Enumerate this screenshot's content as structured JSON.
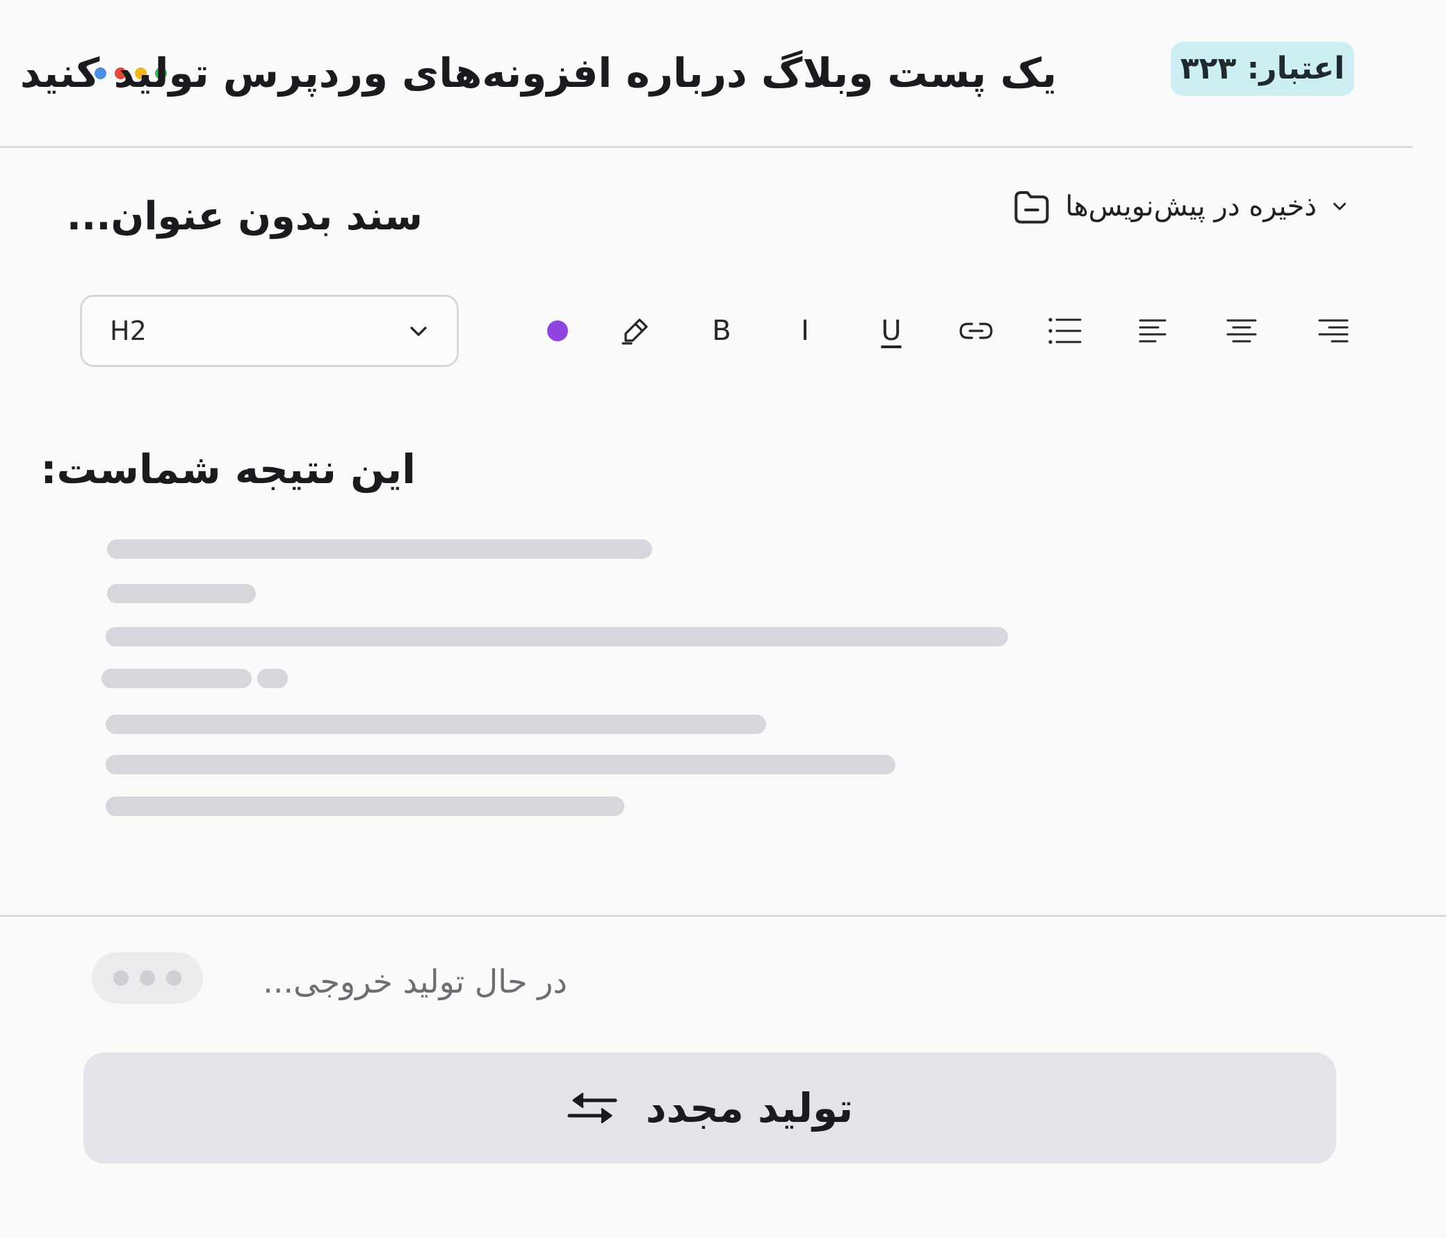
{
  "header": {
    "window_dots": [
      "#4a8fe0",
      "#e1483c",
      "#f2b520",
      "#41b35a"
    ],
    "prompt_title": "یک پست وبلاگ درباره افزونه‌های وردپرس تولید کنید",
    "credit_badge": "اعتبار: ۳۲۳"
  },
  "document": {
    "title": "سند بدون عنوان...",
    "save_dropdown_label": "ذخیره در پیش‌نویس‌ها"
  },
  "toolbar": {
    "heading_select_value": "H2",
    "text_color": "#8f44e0",
    "bold_label": "B",
    "italic_label": "I",
    "underline_label": "U",
    "icons": [
      "text-color-icon",
      "highlighter-icon",
      "bold-icon",
      "italic-icon",
      "underline-icon",
      "link-icon",
      "bullet-list-icon",
      "align-left-icon",
      "align-center-icon",
      "align-right-icon"
    ]
  },
  "content": {
    "result_heading": "این نتیجه شماست:"
  },
  "footer": {
    "status_text": "در حال تولید خروجی...",
    "regenerate_label": "تولید مجدد"
  },
  "colors": {
    "credit_badge_bg": "#cdeef3",
    "skeleton": "#d6d7dc",
    "button_bg": "#e3e4e9"
  }
}
